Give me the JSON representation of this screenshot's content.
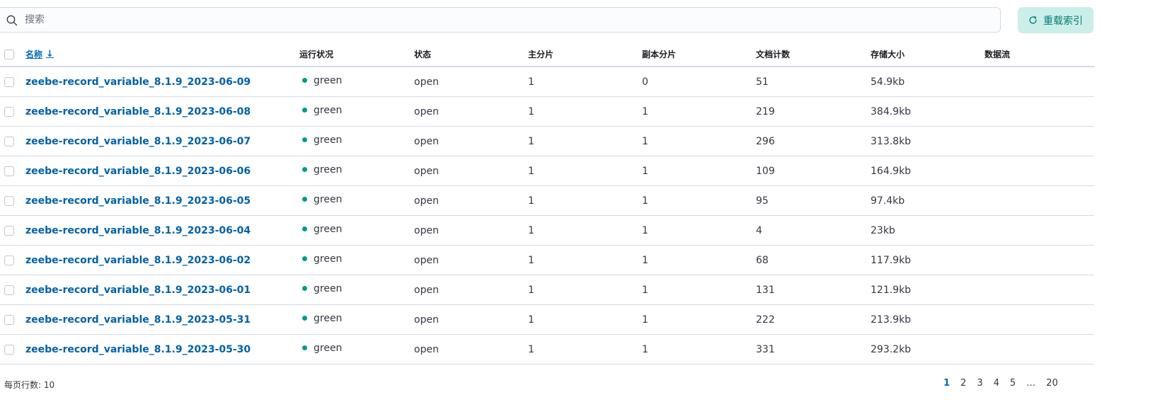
{
  "search": {
    "placeholder": "搜索",
    "value": ""
  },
  "toolbar": {
    "reload_label": "重载索引",
    "reload_bg": "#cceee9",
    "reload_color": "#017d73"
  },
  "table": {
    "columns": {
      "name": "名称",
      "health": "运行状况",
      "status": "状态",
      "primary": "主分片",
      "replica": "副本分片",
      "docs": "文档计数",
      "size": "存储大小",
      "datastream": "数据流"
    },
    "sort": {
      "column": "name",
      "direction": "descending",
      "icon": "arrow-down-icon"
    },
    "health_color": "#009a8b",
    "rows": [
      {
        "name": "zeebe-record_variable_8.1.9_2023-06-09",
        "health": "green",
        "status": "open",
        "primary": "1",
        "replica": "0",
        "docs": "51",
        "size": "54.9kb",
        "datastream": ""
      },
      {
        "name": "zeebe-record_variable_8.1.9_2023-06-08",
        "health": "green",
        "status": "open",
        "primary": "1",
        "replica": "1",
        "docs": "219",
        "size": "384.9kb",
        "datastream": ""
      },
      {
        "name": "zeebe-record_variable_8.1.9_2023-06-07",
        "health": "green",
        "status": "open",
        "primary": "1",
        "replica": "1",
        "docs": "296",
        "size": "313.8kb",
        "datastream": ""
      },
      {
        "name": "zeebe-record_variable_8.1.9_2023-06-06",
        "health": "green",
        "status": "open",
        "primary": "1",
        "replica": "1",
        "docs": "109",
        "size": "164.9kb",
        "datastream": ""
      },
      {
        "name": "zeebe-record_variable_8.1.9_2023-06-05",
        "health": "green",
        "status": "open",
        "primary": "1",
        "replica": "1",
        "docs": "95",
        "size": "97.4kb",
        "datastream": ""
      },
      {
        "name": "zeebe-record_variable_8.1.9_2023-06-04",
        "health": "green",
        "status": "open",
        "primary": "1",
        "replica": "1",
        "docs": "4",
        "size": "23kb",
        "datastream": ""
      },
      {
        "name": "zeebe-record_variable_8.1.9_2023-06-02",
        "health": "green",
        "status": "open",
        "primary": "1",
        "replica": "1",
        "docs": "68",
        "size": "117.9kb",
        "datastream": ""
      },
      {
        "name": "zeebe-record_variable_8.1.9_2023-06-01",
        "health": "green",
        "status": "open",
        "primary": "1",
        "replica": "1",
        "docs": "131",
        "size": "121.9kb",
        "datastream": ""
      },
      {
        "name": "zeebe-record_variable_8.1.9_2023-05-31",
        "health": "green",
        "status": "open",
        "primary": "1",
        "replica": "1",
        "docs": "222",
        "size": "213.9kb",
        "datastream": ""
      },
      {
        "name": "zeebe-record_variable_8.1.9_2023-05-30",
        "health": "green",
        "status": "open",
        "primary": "1",
        "replica": "1",
        "docs": "331",
        "size": "293.2kb",
        "datastream": ""
      }
    ]
  },
  "footer": {
    "rows_per_page_label": "每页行数: 10",
    "pages": [
      "1",
      "2",
      "3",
      "4",
      "5",
      "…",
      "20"
    ],
    "current_page": "1"
  }
}
